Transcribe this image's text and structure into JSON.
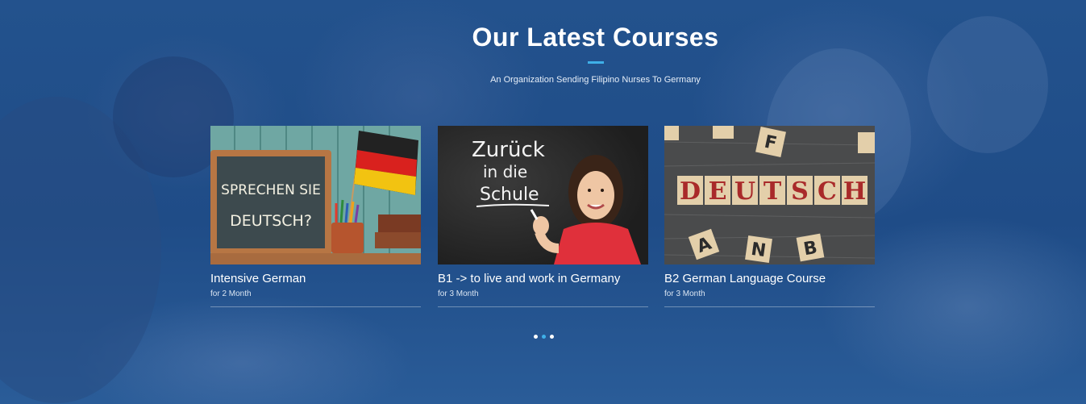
{
  "section": {
    "title": "Our Latest Courses",
    "subtitle": "An Organization Sending Filipino Nurses To Germany"
  },
  "courses": [
    {
      "name": "Intensive German",
      "duration": "for 2 Month",
      "image_text": [
        "SPRECHEN SIE",
        "DEUTSCH?"
      ]
    },
    {
      "name": "B1 -> to live and work in Germany",
      "duration": "for 3 Month",
      "image_text": [
        "Zurück",
        "in die",
        "Schule"
      ]
    },
    {
      "name": "B2 German Language Course",
      "duration": "for 3 Month",
      "image_text": [
        "D",
        "E",
        "U",
        "T",
        "S",
        "C",
        "H"
      ],
      "scattered_letters": [
        "F",
        "A",
        "N",
        "B"
      ]
    }
  ],
  "carousel": {
    "pages": 3,
    "active_index": 1
  },
  "colors": {
    "accent": "#3fb0e8",
    "overlay": "#1f4e8a"
  }
}
